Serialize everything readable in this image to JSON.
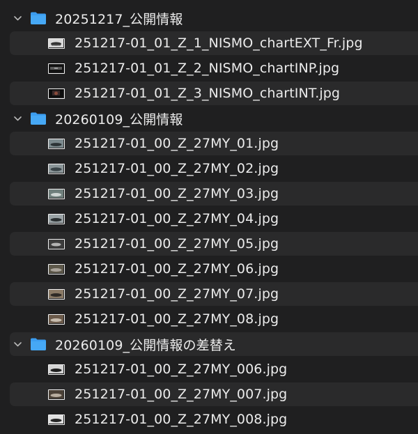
{
  "folders": [
    {
      "name": "20251217_公開情報",
      "files": [
        "251217-01_01_Z_1_NISMO_chartEXT_Fr.jpg",
        "251217-01_01_Z_2_NISMO_chartINP.jpg",
        "251217-01_01_Z_3_NISMO_chartINT.jpg"
      ]
    },
    {
      "name": "20260109_公開情報",
      "files": [
        "251217-01_00_Z_27MY_01.jpg",
        "251217-01_00_Z_27MY_02.jpg",
        "251217-01_00_Z_27MY_03.jpg",
        "251217-01_00_Z_27MY_04.jpg",
        "251217-01_00_Z_27MY_05.jpg",
        "251217-01_00_Z_27MY_06.jpg",
        "251217-01_00_Z_27MY_07.jpg",
        "251217-01_00_Z_27MY_08.jpg"
      ]
    },
    {
      "name": "20260109_公開情報の差替え",
      "files": [
        "251217-01_00_Z_27MY_006.jpg",
        "251217-01_00_Z_27MY_007.jpg",
        "251217-01_00_Z_27MY_008.jpg"
      ]
    }
  ],
  "colors": {
    "folder": "#3b9df0",
    "chevron": "#b8b8b8"
  },
  "icons": {
    "disclosure": "chevron-down-icon",
    "folder": "folder-icon",
    "file": "image-thumbnail-icon"
  }
}
